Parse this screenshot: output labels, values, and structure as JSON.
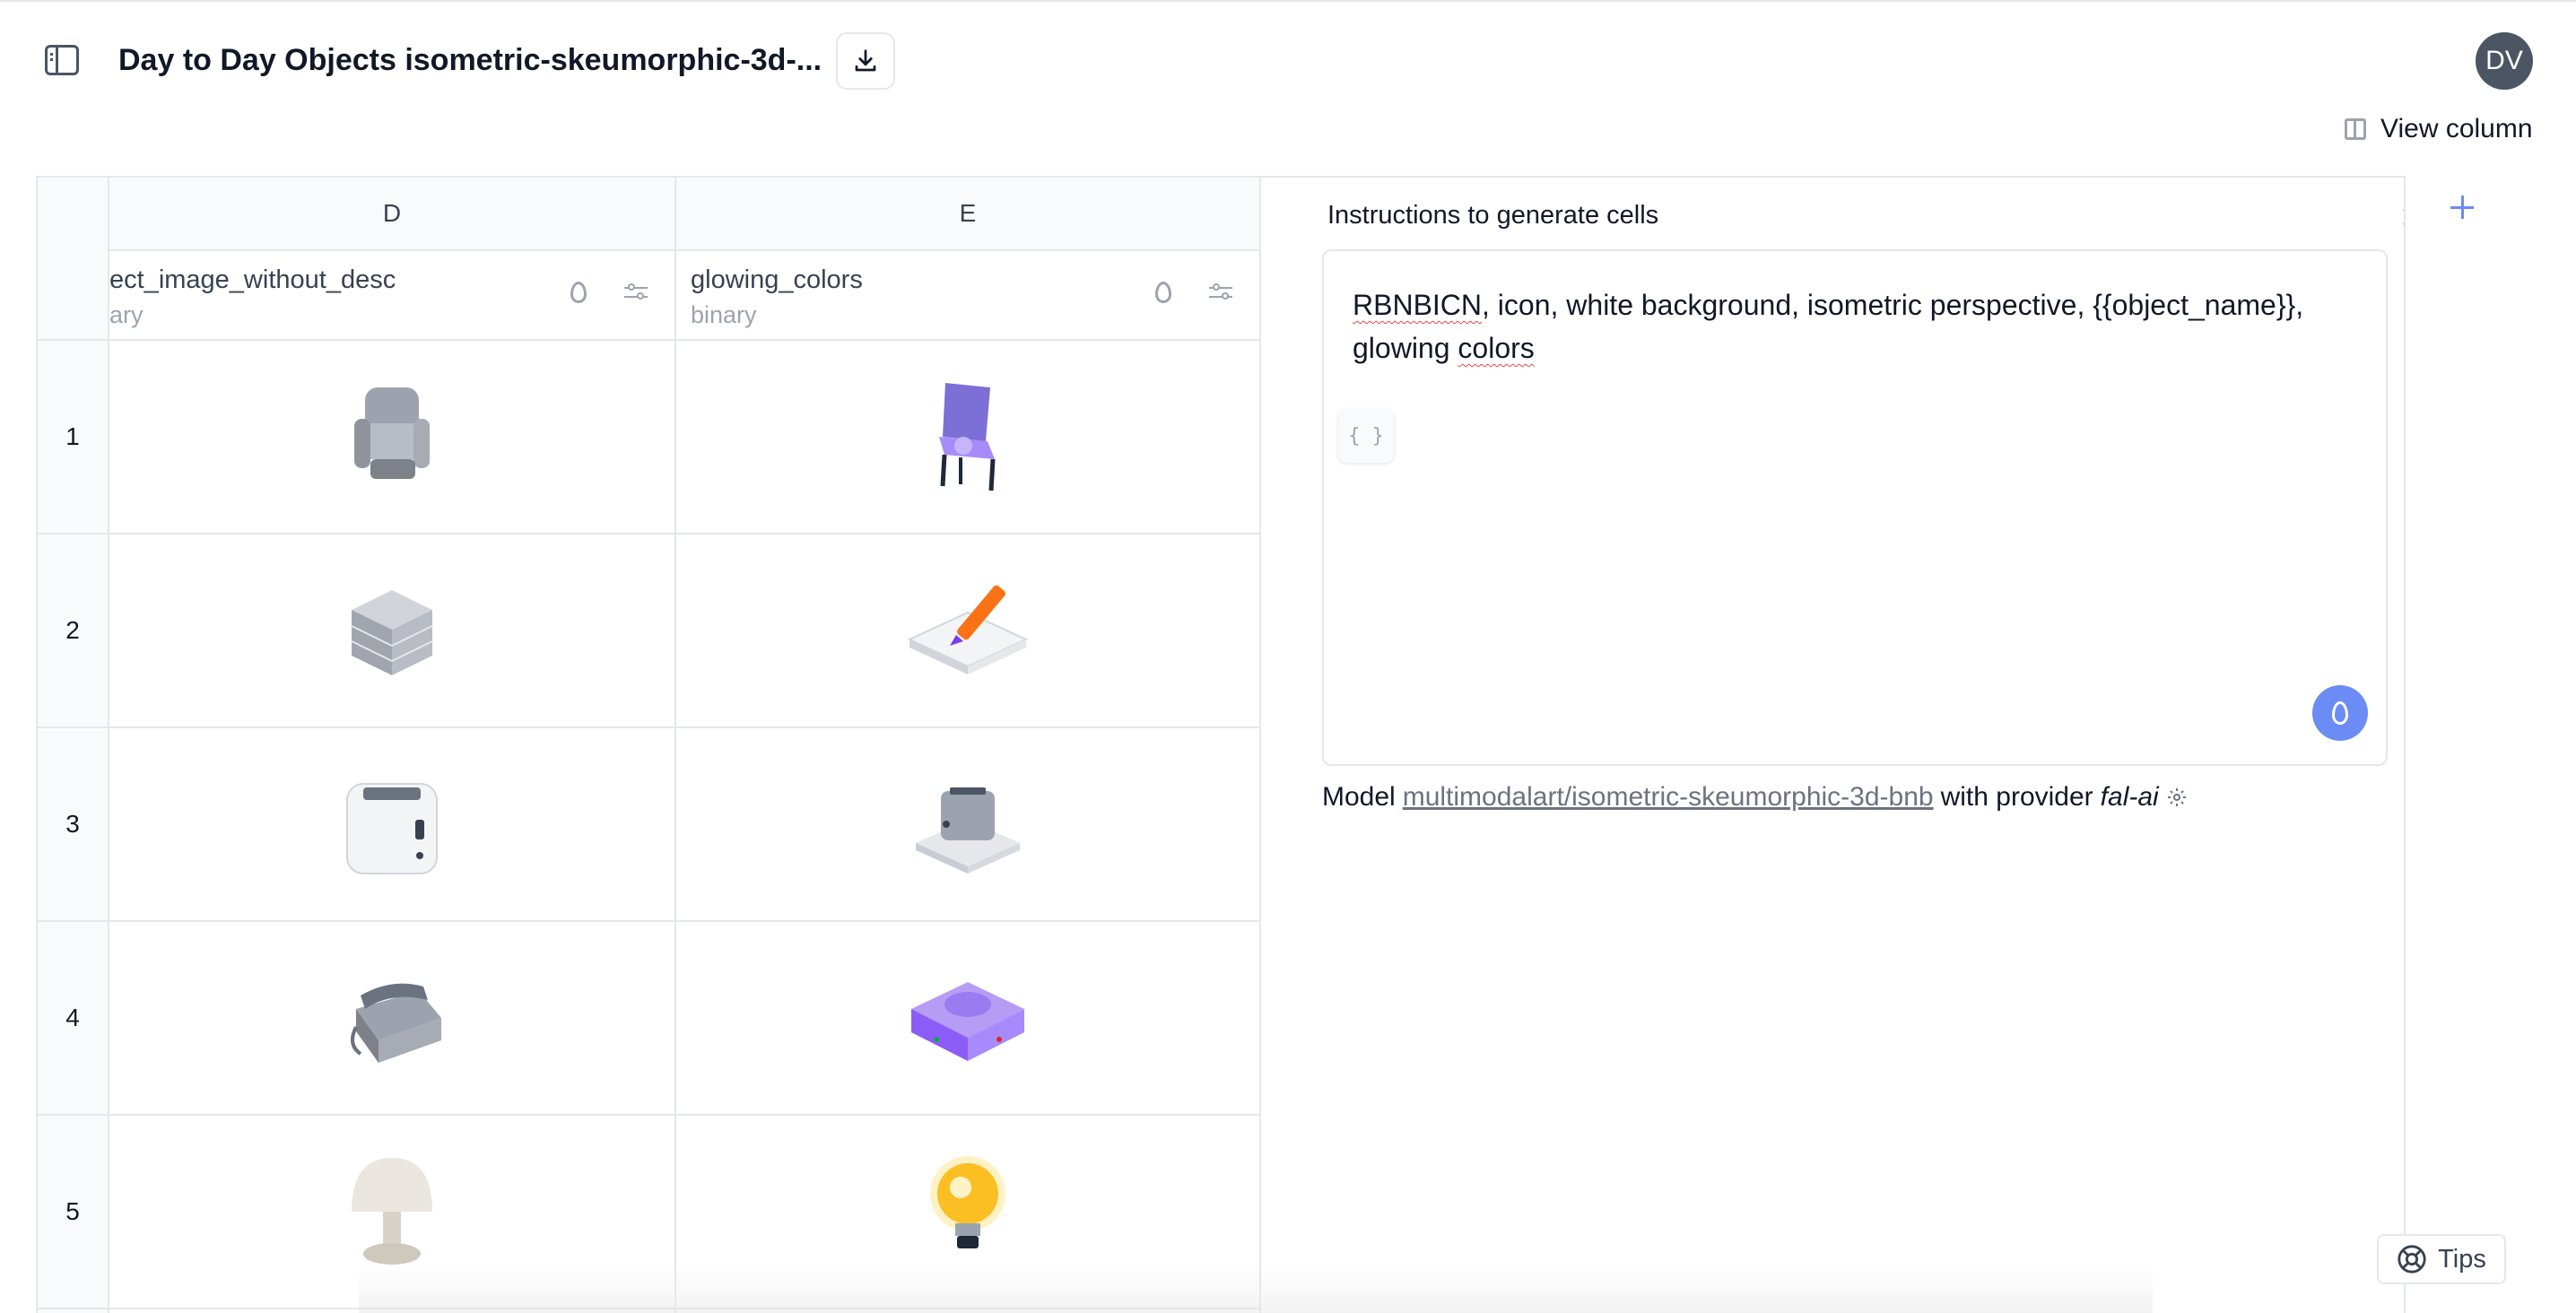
{
  "header": {
    "title": "Day to Day Objects isometric-skeumorphic-3d-...",
    "avatar_initials": "DV",
    "view_column_label": "View column"
  },
  "table": {
    "columns": [
      {
        "letter": "D",
        "name": "ect_image_without_desc",
        "type": "ary"
      },
      {
        "letter": "E",
        "name": "glowing_colors",
        "type": "binary"
      }
    ],
    "rows": [
      {
        "num": "1",
        "d_image": "gray-armchair-icon",
        "e_image": "purple-glowing-chair-icon"
      },
      {
        "num": "2",
        "d_image": "gray-stacked-box-icon",
        "e_image": "orange-pencil-on-tablet-icon"
      },
      {
        "num": "3",
        "d_image": "white-toaster-icon",
        "e_image": "small-toaster-icon"
      },
      {
        "num": "4",
        "d_image": "gray-telephone-icon",
        "e_image": "purple-telephone-icon"
      },
      {
        "num": "5",
        "d_image": "white-mushroom-lamp-icon",
        "e_image": "glowing-lightbulb-icon"
      }
    ]
  },
  "panel": {
    "title": "Instructions to generate cells",
    "prompt_part1": "RBNBICN",
    "prompt_part2": ", icon, white background, isometric perspective, {{object_name}}, glowing ",
    "prompt_part3": "colors",
    "variable_button": "{ }",
    "model_prefix": "Model",
    "model_name": "multimodalart/isometric-skeumorphic-3d-bnb",
    "model_middle": "with provider",
    "provider": "fal-ai"
  },
  "tips_label": "Tips",
  "colors": {
    "accent": "#6b8cf5",
    "border": "#e5e7eb",
    "avatar": "#4b5563"
  }
}
